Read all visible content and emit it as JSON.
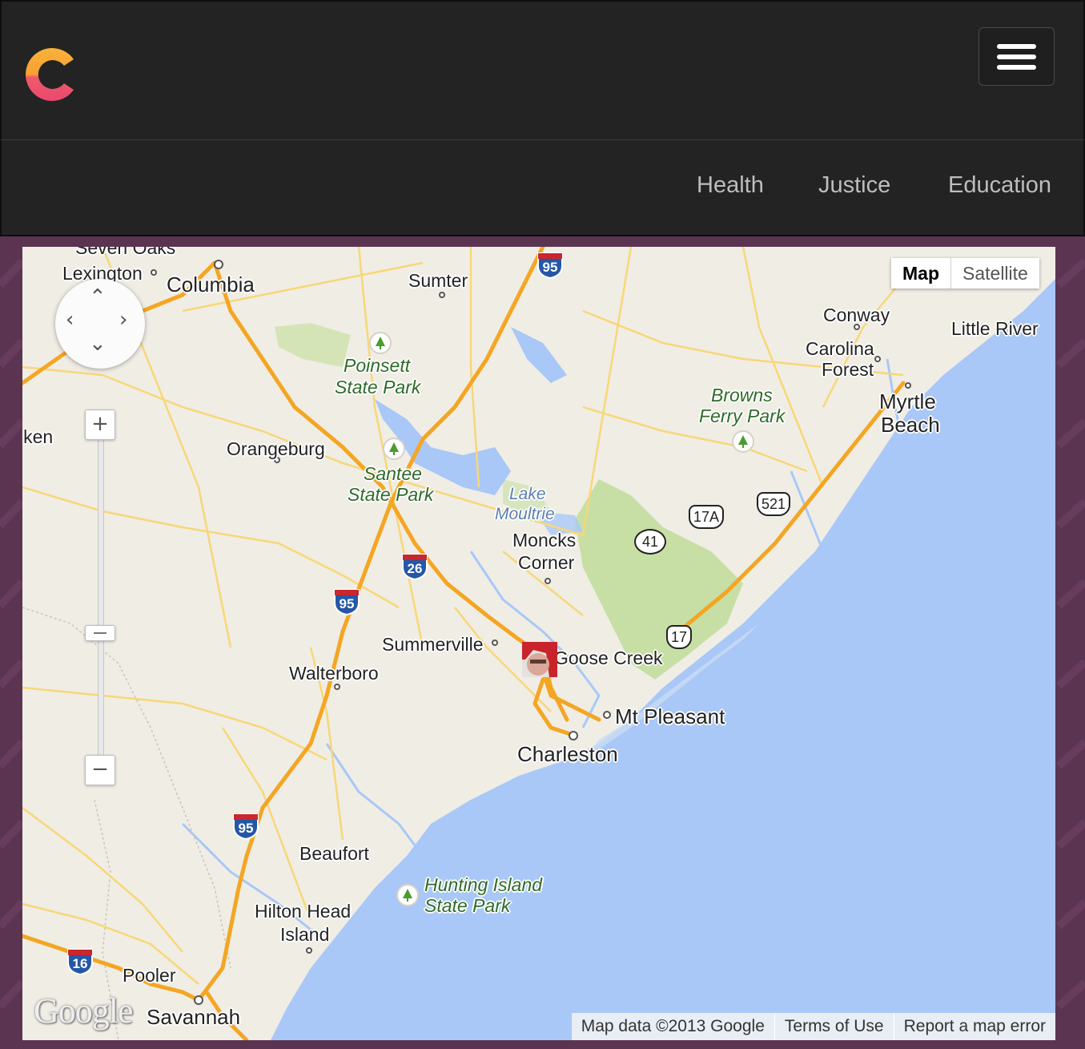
{
  "header": {
    "logo_alt": "C",
    "menu_label": "Menu"
  },
  "nav": {
    "items": [
      {
        "label": "Health"
      },
      {
        "label": "Justice"
      },
      {
        "label": "Education"
      }
    ]
  },
  "map": {
    "map_type": {
      "map_label": "Map",
      "satellite_label": "Satellite",
      "selected": "Map"
    },
    "zoom": {
      "in_label": "+",
      "out_label": "−"
    },
    "cities": {
      "seven_oaks": "Seven Oaks",
      "lexington": "Lexington",
      "columbia": "Columbia",
      "sumter": "Sumter",
      "conway": "Conway",
      "little_river": "Little River",
      "carolina_forest_1": "Carolina",
      "carolina_forest_2": "Forest",
      "myrtle_beach_1": "Myrtle",
      "myrtle_beach_2": "Beach",
      "aiken": "iken",
      "orangeburg": "Orangeburg",
      "moncks_corner_1": "Moncks",
      "moncks_corner_2": "Corner",
      "summerville": "Summerville",
      "goose_creek": "Goose Creek",
      "walterboro": "Walterboro",
      "mt_pleasant": "Mt Pleasant",
      "charleston": "Charleston",
      "beaufort": "Beaufort",
      "hilton_head_1": "Hilton Head",
      "hilton_head_2": "Island",
      "pooler": "Pooler",
      "savannah": "Savannah"
    },
    "parks": {
      "poinsett_1": "Poinsett",
      "poinsett_2": "State Park",
      "santee_1": "Santee",
      "santee_2": "State Park",
      "browns_ferry_1": "Browns",
      "browns_ferry_2": "Ferry Park",
      "hunting_island_1": "Hunting Island",
      "hunting_island_2": "State Park"
    },
    "water": {
      "lake_moultrie_1": "Lake",
      "lake_moultrie_2": "Moultrie"
    },
    "routes": {
      "i95_north": "95",
      "i26": "26",
      "i95_mid": "95",
      "i95_south": "95",
      "i16": "16",
      "us17a": "17A",
      "us521": "521",
      "sc41": "41",
      "us17": "17"
    },
    "attribution": {
      "data": "Map data ©2013 Google",
      "terms": "Terms of Use",
      "report": "Report a map error"
    },
    "google_logo": "Google",
    "colors": {
      "land": "#f0ede5",
      "water": "#a9c8f7",
      "highway": "#f4a623",
      "park": "#c7dfa4"
    }
  }
}
